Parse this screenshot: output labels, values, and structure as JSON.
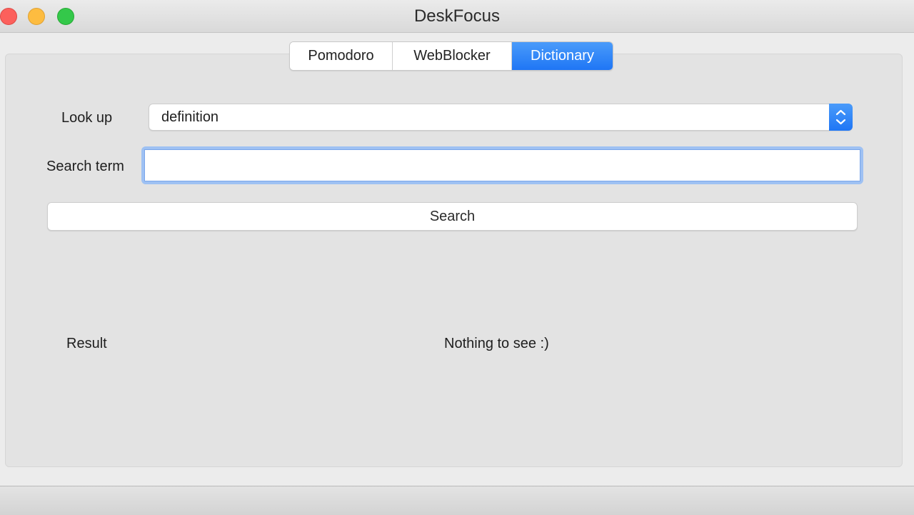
{
  "window": {
    "title": "DeskFocus",
    "controls": [
      "close",
      "minimize",
      "zoom"
    ]
  },
  "tabs": [
    {
      "label": "Pomodoro",
      "active": false
    },
    {
      "label": "WebBlocker",
      "active": false
    },
    {
      "label": "Dictionary",
      "active": true
    }
  ],
  "form": {
    "lookup_label": "Look up",
    "lookup_value": "definition",
    "search_term_label": "Search term",
    "search_term_value": "",
    "search_button_label": "Search"
  },
  "result": {
    "label": "Result",
    "value": "Nothing to see :)"
  },
  "colors": {
    "accent": "#1f76f5",
    "close": "#fc605c",
    "minimize": "#fdbc40",
    "zoom": "#34c84a"
  }
}
